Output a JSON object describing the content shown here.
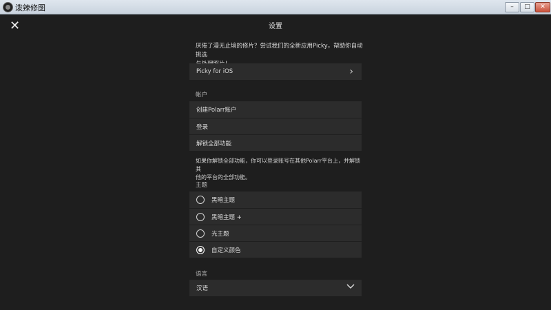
{
  "window": {
    "title": "泼辣修图"
  },
  "header": {
    "title": "设置"
  },
  "promo": {
    "text_line1": "厌倦了漫无止境的修片？尝试我们的全新应用Picky，帮助你自动挑选",
    "text_line2": "与处理照片！",
    "ios_label": "Picky for iOS"
  },
  "account": {
    "section_label": "帐户",
    "items": [
      {
        "label": "创建Polarr账户"
      },
      {
        "label": "登录"
      },
      {
        "label": "解锁全部功能"
      }
    ],
    "note_line1": "如果你解锁全部功能，你可以登录账号在其他Polarr平台上，并解锁其",
    "note_line2": "他的平台的全部功能。"
  },
  "theme": {
    "section_label": "主题",
    "options": [
      {
        "label": "黑暗主题",
        "selected": false
      },
      {
        "label": "黑暗主题 +",
        "selected": false
      },
      {
        "label": "光主题",
        "selected": false
      },
      {
        "label": "自定义颜色",
        "selected": true
      }
    ]
  },
  "language": {
    "section_label": "语言",
    "selected": "汉语"
  }
}
